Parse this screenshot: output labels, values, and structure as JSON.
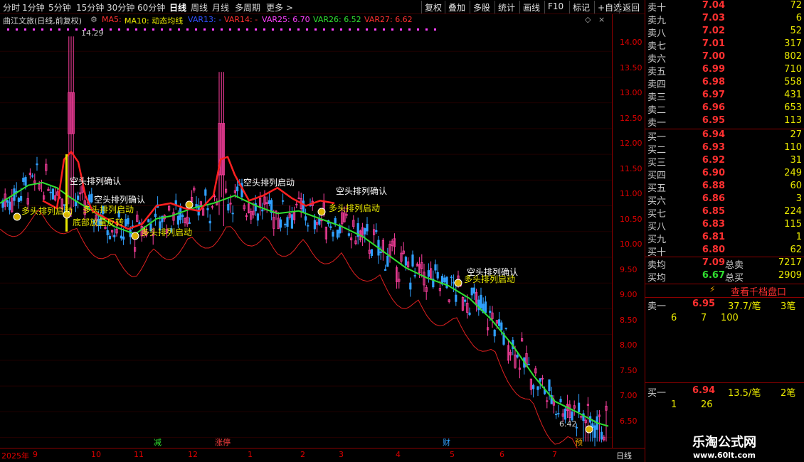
{
  "toolbar": {
    "timeframes": [
      "分时",
      "1分钟",
      "5分钟",
      "15分钟",
      "30分钟",
      "60分钟",
      "日线",
      "周线",
      "月线",
      "多周期",
      "更多 >"
    ],
    "active_timeframe": "日线",
    "right_buttons": [
      "复权",
      "叠加",
      "多股",
      "统计",
      "画线",
      "F10",
      "标记",
      "+自选",
      "返回"
    ]
  },
  "legend": {
    "title": "曲江文旅(日线,前复权)",
    "items": [
      {
        "text": "MA5: -",
        "color": "#ff3030"
      },
      {
        "text": "MA10: 动态均线",
        "color": "#e8e800"
      },
      {
        "text": "VAR13: -",
        "color": "#3050ff"
      },
      {
        "text": "VAR14: -",
        "color": "#ff3030"
      },
      {
        "text": "VAR25: 6.70",
        "color": "#ff40ff"
      },
      {
        "text": "VAR26: 6.52",
        "color": "#30e030"
      },
      {
        "text": "VAR27: 6.62",
        "color": "#ff3030"
      }
    ]
  },
  "yaxis": {
    "ticks": [
      "14.00",
      "13.50",
      "13.00",
      "12.50",
      "12.00",
      "11.50",
      "11.00",
      "10.50",
      "10.00",
      "9.50",
      "9.00",
      "8.50",
      "8.00",
      "7.50",
      "7.00",
      "6.50"
    ]
  },
  "xaxis": {
    "labels": [
      "2025年",
      "9",
      "10",
      "11",
      "12",
      "1",
      "2",
      "3",
      "4",
      "5",
      "6",
      "7",
      "日线"
    ]
  },
  "chart_data": {
    "type": "candlestick",
    "ylim": [
      6.3,
      14.5
    ],
    "markers": {
      "high": "14.29",
      "low": "6.42"
    },
    "trend_line": {
      "name": "VAR26",
      "points": [
        [
          0,
          11.05
        ],
        [
          40,
          11.4
        ],
        [
          60,
          11.45
        ],
        [
          80,
          11.35
        ],
        [
          100,
          11.15
        ],
        [
          130,
          10.9
        ],
        [
          160,
          10.6
        ],
        [
          190,
          10.45
        ],
        [
          220,
          10.75
        ],
        [
          240,
          10.8
        ],
        [
          270,
          10.95
        ],
        [
          300,
          11.05
        ],
        [
          330,
          11.2
        ],
        [
          360,
          11.0
        ],
        [
          390,
          10.85
        ],
        [
          420,
          10.9
        ],
        [
          450,
          10.75
        ],
        [
          480,
          10.6
        ],
        [
          510,
          10.4
        ],
        [
          540,
          10.1
        ],
        [
          570,
          9.8
        ],
        [
          600,
          9.6
        ],
        [
          630,
          9.45
        ],
        [
          660,
          9.2
        ],
        [
          690,
          8.8
        ],
        [
          720,
          8.3
        ],
        [
          750,
          7.7
        ],
        [
          780,
          7.2
        ],
        [
          810,
          7.0
        ],
        [
          840,
          6.78
        ],
        [
          855,
          6.72
        ]
      ]
    },
    "red_line": {
      "name": "MA5",
      "points": [
        [
          60,
          11.1
        ],
        [
          80,
          10.95
        ],
        [
          90,
          11.9
        ],
        [
          100,
          12.05
        ],
        [
          110,
          11.85
        ],
        [
          120,
          11.2
        ],
        [
          130,
          10.9
        ],
        [
          150,
          10.75
        ],
        [
          180,
          10.55
        ],
        [
          200,
          10.65
        ],
        [
          220,
          11.0
        ],
        [
          240,
          11.05
        ],
        [
          260,
          10.95
        ],
        [
          280,
          10.9
        ],
        [
          300,
          11.2
        ],
        [
          310,
          11.9
        ],
        [
          320,
          11.95
        ],
        [
          330,
          11.6
        ],
        [
          350,
          11.1
        ],
        [
          370,
          11.2
        ],
        [
          390,
          11.35
        ],
        [
          410,
          11.15
        ],
        [
          430,
          11.0
        ],
        [
          450,
          11.1
        ],
        [
          470,
          11.05
        ]
      ]
    }
  },
  "signals": [
    {
      "text": "空头排列确认",
      "color": "#ffffff"
    },
    {
      "text": "多头排列启动",
      "color": "#e8e800"
    },
    {
      "text": "空头排列确认",
      "color": "#ffffff"
    },
    {
      "text": "多头排列启动",
      "color": "#e8e800"
    },
    {
      "text": "底部放量反转",
      "color": "#e8e800"
    },
    {
      "text": "多头排列启动",
      "color": "#e8e800"
    },
    {
      "text": "空头排列启动",
      "color": "#ffffff"
    },
    {
      "text": "空头排列确认",
      "color": "#ffffff"
    },
    {
      "text": "多头排列启动",
      "color": "#e8e800"
    },
    {
      "text": "空头排列确认",
      "color": "#ffffff"
    },
    {
      "text": "多头排列启动",
      "color": "#e8e800"
    }
  ],
  "events": [
    {
      "text": "减",
      "color": "#30e030"
    },
    {
      "text": "涨停",
      "color": "#ff4040"
    },
    {
      "text": "财",
      "color": "#30a0ff"
    },
    {
      "text": "预",
      "color": "#e8a000"
    }
  ],
  "orderbook": {
    "asks": [
      {
        "name": "卖十",
        "price": "7.04",
        "vol": "72"
      },
      {
        "name": "卖九",
        "price": "7.03",
        "vol": "6"
      },
      {
        "name": "卖八",
        "price": "7.02",
        "vol": "52"
      },
      {
        "name": "卖七",
        "price": "7.01",
        "vol": "317"
      },
      {
        "name": "卖六",
        "price": "7.00",
        "vol": "802"
      },
      {
        "name": "卖五",
        "price": "6.99",
        "vol": "710"
      },
      {
        "name": "卖四",
        "price": "6.98",
        "vol": "558"
      },
      {
        "name": "卖三",
        "price": "6.97",
        "vol": "431"
      },
      {
        "name": "卖二",
        "price": "6.96",
        "vol": "653"
      },
      {
        "name": "卖一",
        "price": "6.95",
        "vol": "113"
      }
    ],
    "bids": [
      {
        "name": "买一",
        "price": "6.94",
        "vol": "27"
      },
      {
        "name": "买二",
        "price": "6.93",
        "vol": "110"
      },
      {
        "name": "买三",
        "price": "6.92",
        "vol": "31"
      },
      {
        "name": "买四",
        "price": "6.90",
        "vol": "249"
      },
      {
        "name": "买五",
        "price": "6.88",
        "vol": "60"
      },
      {
        "name": "买六",
        "price": "6.86",
        "vol": "3"
      },
      {
        "name": "买七",
        "price": "6.85",
        "vol": "224"
      },
      {
        "name": "买八",
        "price": "6.83",
        "vol": "115"
      },
      {
        "name": "买九",
        "price": "6.81",
        "vol": "1"
      },
      {
        "name": "买十",
        "price": "6.80",
        "vol": "62"
      }
    ],
    "avg_sell": {
      "label": "卖均",
      "price": "7.09",
      "total_label": "总卖",
      "total": "7217"
    },
    "avg_buy": {
      "label": "买均",
      "price": "6.67",
      "total_label": "总买",
      "total": "2909"
    },
    "view_button": "查看千档盘口",
    "ask1_detail": {
      "label": "卖一",
      "price": "6.95",
      "amount": "37.7/笔",
      "count": "3笔",
      "row": [
        "6",
        "7",
        "100"
      ]
    },
    "bid1_detail": {
      "label": "买一",
      "price": "6.94",
      "amount": "13.5/笔",
      "count": "2笔",
      "row": [
        "1",
        "26"
      ]
    }
  },
  "watermark": {
    "line1": "乐淘公式网",
    "line2": "www.60lt.com"
  }
}
